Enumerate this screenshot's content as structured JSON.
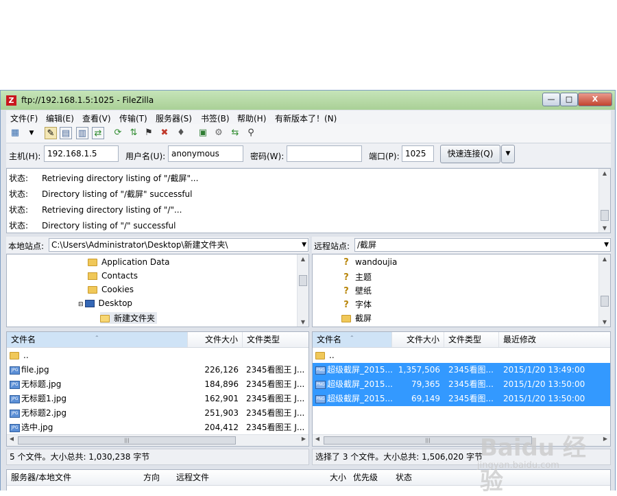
{
  "window": {
    "title": "ftp://192.168.1.5:1025 - FileZilla",
    "app_icon_glyph": "Z",
    "minimize_glyph": "—",
    "maximize_glyph": "□",
    "close_glyph": "X"
  },
  "menu": [
    "文件(F)",
    "编辑(E)",
    "查看(V)",
    "传输(T)",
    "服务器(S)",
    "书签(B)",
    "帮助(H)",
    "有新版本了！(N)"
  ],
  "toolbar_icons": [
    "site-manager-icon",
    "dropdown-arrow-icon",
    "toggle-log-icon",
    "toggle-local-tree-icon",
    "toggle-remote-tree-icon",
    "toggle-queue-icon",
    "refresh-icon",
    "process-queue-icon",
    "cancel-icon",
    "disconnect-icon",
    "reconnect-icon",
    "directory-compare-icon",
    "filter-icon",
    "sync-browse-icon",
    "search-icon"
  ],
  "quickconnect": {
    "host_label": "主机(H):",
    "host_value": "192.168.1.5",
    "user_label": "用户名(U):",
    "user_value": "anonymous",
    "pass_label": "密码(W):",
    "pass_value": "",
    "port_label": "端口(P):",
    "port_value": "1025",
    "connect_label": "快速连接(Q)",
    "dropdown_glyph": "▼"
  },
  "log": [
    {
      "label": "状态:",
      "message": "Retrieving directory listing of \"/截屏\"..."
    },
    {
      "label": "状态:",
      "message": "Directory listing of \"/截屏\" successful"
    },
    {
      "label": "状态:",
      "message": "Retrieving directory listing of \"/\"..."
    },
    {
      "label": "状态:",
      "message": "Directory listing of \"/\" successful"
    }
  ],
  "local": {
    "site_label": "本地站点:",
    "path": "C:\\Users\\Administrator\\Desktop\\新建文件夹\\",
    "tree": [
      {
        "name": "Application Data",
        "icon": "folder"
      },
      {
        "name": "Contacts",
        "icon": "contact"
      },
      {
        "name": "Cookies",
        "icon": "folder"
      },
      {
        "name": "Desktop",
        "icon": "desktop"
      },
      {
        "name": "新建文件夹",
        "icon": "folder-open"
      }
    ],
    "columns": {
      "name": "文件名",
      "size": "文件大小",
      "type": "文件类型"
    },
    "parent": "..",
    "files": [
      {
        "name": "file.jpg",
        "size": "226,126",
        "type": "2345看图王 J..."
      },
      {
        "name": "无标题.jpg",
        "size": "184,896",
        "type": "2345看图王 J..."
      },
      {
        "name": "无标题1.jpg",
        "size": "162,901",
        "type": "2345看图王 J..."
      },
      {
        "name": "无标题2.jpg",
        "size": "251,903",
        "type": "2345看图王 J..."
      },
      {
        "name": "选中.jpg",
        "size": "204,412",
        "type": "2345看图王 J..."
      }
    ],
    "status": "5 个文件。大小总共: 1,030,238 字节"
  },
  "remote": {
    "site_label": "远程站点:",
    "path": "/截屏",
    "tree": [
      {
        "name": "wandoujia",
        "icon": "question"
      },
      {
        "name": "主题",
        "icon": "question"
      },
      {
        "name": "壁纸",
        "icon": "question"
      },
      {
        "name": "字体",
        "icon": "question"
      },
      {
        "name": "截屏",
        "icon": "folder"
      }
    ],
    "columns": {
      "name": "文件名",
      "size": "文件大小",
      "type": "文件类型",
      "modified": "最近修改"
    },
    "parent": "..",
    "files": [
      {
        "name": "超级截屏_2015...",
        "size": "1,357,506",
        "type": "2345看图...",
        "modified": "2015/1/20 13:49:00"
      },
      {
        "name": "超级截屏_2015...",
        "size": "79,365",
        "type": "2345看图...",
        "modified": "2015/1/20 13:50:00"
      },
      {
        "name": "超级截屏_2015...",
        "size": "69,149",
        "type": "2345看图...",
        "modified": "2015/1/20 13:50:00"
      }
    ],
    "status": "选择了 3 个文件。大小总共: 1,506,020 字节"
  },
  "queue": {
    "columns": {
      "server_local": "服务器/本地文件",
      "direction": "方向",
      "remote_file": "远程文件",
      "size": "大小",
      "priority": "优先级",
      "status": "状态"
    }
  },
  "watermark": {
    "brand": "Baidu 经验",
    "url": "jingyan.baidu.com"
  },
  "colors": {
    "selection": "#3399ff",
    "titlebar": "#b6da a4",
    "close": "#c2452f"
  }
}
